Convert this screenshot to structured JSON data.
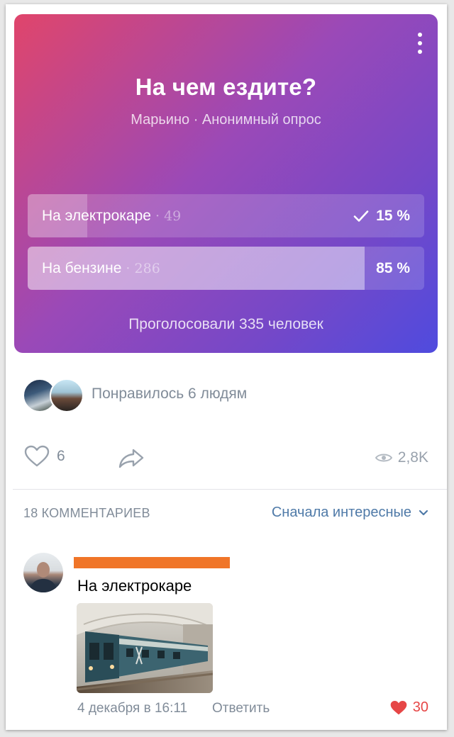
{
  "poll": {
    "title": "На чем ездите?",
    "subtitle": "Марьино · Анонимный опрос",
    "options": [
      {
        "label": "На электрокаре",
        "count": "49",
        "percent_text": "15 %",
        "percent": 15,
        "voted": true
      },
      {
        "label": "На бензине",
        "count": "286",
        "percent_text": "85 %",
        "percent": 85,
        "voted": false
      }
    ],
    "total": "Проголосовали 335 человек",
    "menu_icon": "more-vertical-icon"
  },
  "likes": {
    "text": "Понравилось 6 людям"
  },
  "actions": {
    "like_count": "6",
    "views": "2,8K",
    "like_icon": "heart-outline-icon",
    "share_icon": "share-arrow-icon",
    "views_icon": "eye-icon"
  },
  "comments": {
    "count_label": "18 КОММЕНТАРИЕВ",
    "sort_label": "Сначала интересные",
    "items": [
      {
        "text": "На электрокаре",
        "date": "4 декабря в 16:11",
        "reply_label": "Ответить",
        "likes": "30"
      }
    ]
  },
  "colors": {
    "accent_link": "#4f7aa8",
    "like_red": "#e64646",
    "secondary_text": "#818c99",
    "poll_gradient_start": "#e0456b",
    "poll_gradient_end": "#4f4bde",
    "redaction": "#f07528"
  }
}
